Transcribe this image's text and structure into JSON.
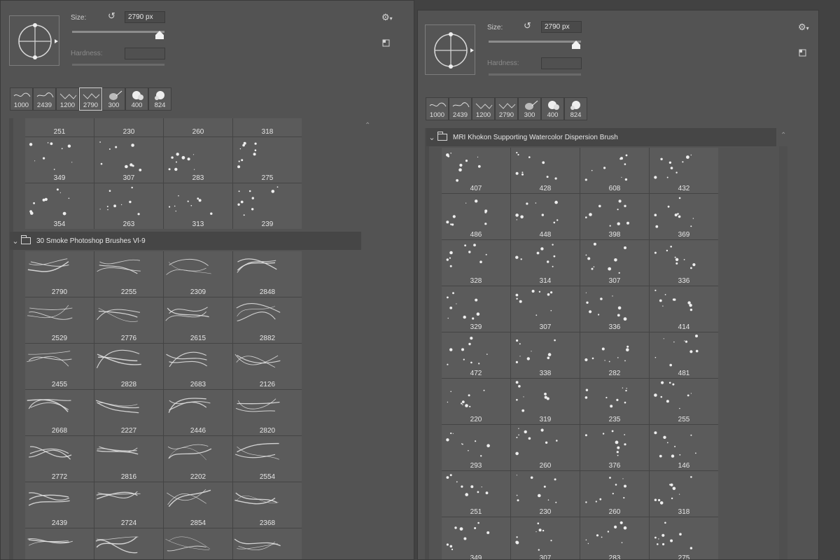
{
  "left_panel": {
    "size_label": "Size:",
    "size_value": "2790 px",
    "hardness_label": "Hardness:",
    "recent_brushes": [
      "1000",
      "2439",
      "1200",
      "2790",
      "300",
      "400",
      "824"
    ],
    "selected_recent": 3,
    "top_rows": [
      [
        "251",
        "230",
        "260",
        "318"
      ],
      [
        "349",
        "307",
        "283",
        "275"
      ],
      [
        "354",
        "263",
        "313",
        "239"
      ]
    ],
    "folder_title": "30 Smoke Photoshop Brushes Vl-9",
    "smoke_rows": [
      [
        "2790",
        "2255",
        "2309",
        "2848"
      ],
      [
        "2529",
        "2776",
        "2615",
        "2882"
      ],
      [
        "2455",
        "2828",
        "2683",
        "2126"
      ],
      [
        "2668",
        "2227",
        "2446",
        "2820"
      ],
      [
        "2772",
        "2816",
        "2202",
        "2554"
      ],
      [
        "2439",
        "2724",
        "2854",
        "2368"
      ],
      [
        "",
        "",
        "",
        ""
      ]
    ]
  },
  "right_panel": {
    "size_label": "Size:",
    "size_value": "2790 px",
    "hardness_label": "Hardness:",
    "recent_brushes": [
      "1000",
      "2439",
      "1200",
      "2790",
      "300",
      "400",
      "824"
    ],
    "folder_title": "MRI Khokon Supporting Watercolor Dispersion Brush",
    "rows": [
      [
        "407",
        "428",
        "608",
        "432"
      ],
      [
        "486",
        "448",
        "398",
        "369"
      ],
      [
        "328",
        "314",
        "307",
        "336"
      ],
      [
        "329",
        "307",
        "336",
        "414"
      ],
      [
        "472",
        "338",
        "282",
        "481"
      ],
      [
        "220",
        "319",
        "235",
        "255"
      ],
      [
        "293",
        "260",
        "376",
        "146"
      ],
      [
        "251",
        "230",
        "260",
        "318"
      ],
      [
        "349",
        "307",
        "283",
        "275"
      ]
    ]
  },
  "icons": {
    "reset": "reset-size-icon",
    "gear": "gear-icon",
    "new_preset": "new-preset-icon",
    "folder": "folder-icon",
    "chevron": "chevron-down-icon",
    "scroll_up": "scroll-up-icon"
  }
}
